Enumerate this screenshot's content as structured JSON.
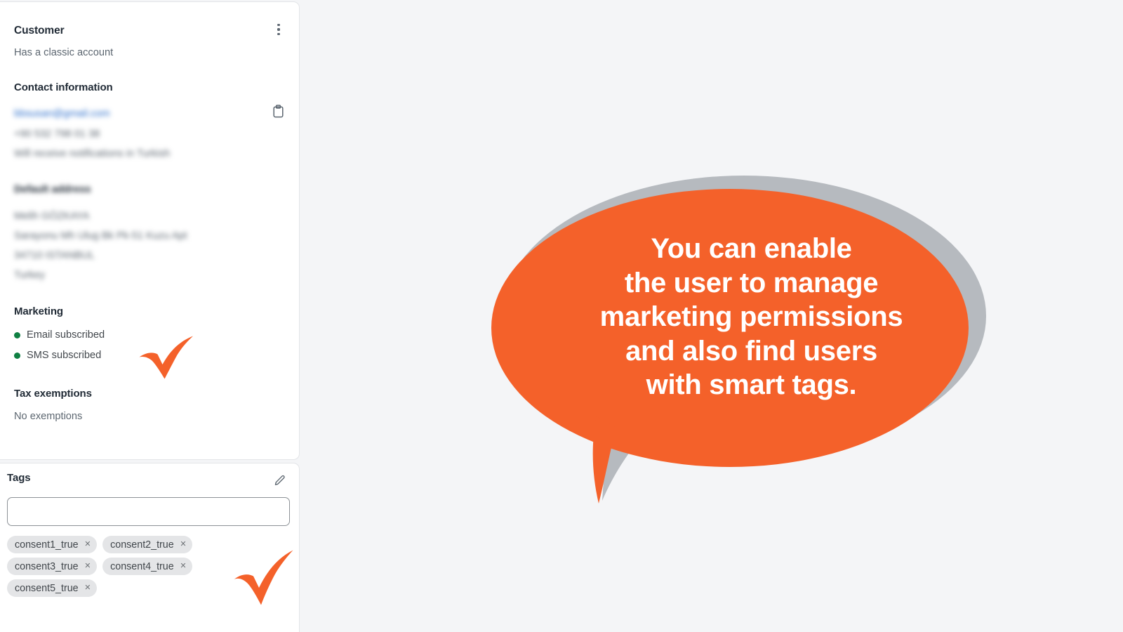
{
  "panel": {
    "customer": {
      "title": "Customer",
      "account_status": "Has a classic account",
      "menu_icon": "kebab-menu-icon"
    },
    "contact": {
      "heading": "Contact information",
      "email_redacted": "bbsusan@gmail.com",
      "phone_redacted": "+90 532 798 01 38",
      "notifications_redacted": "Will receive notifications in Turkish",
      "copy_icon": "clipboard-copy-icon"
    },
    "address": {
      "heading_redacted": "Default address",
      "line1_redacted": "Melih GÖZKAYA",
      "line2_redacted": "Sarayonu Mh Ulug Bk Pk-51 Kuzu Apt",
      "line3_redacted": "34710 ISTANBUL",
      "line4_redacted": "Turkey"
    },
    "marketing": {
      "heading": "Marketing",
      "items": [
        {
          "label": "Email subscribed",
          "status_color": "#108043"
        },
        {
          "label": "SMS subscribed",
          "status_color": "#108043"
        }
      ]
    },
    "tax": {
      "heading": "Tax exemptions",
      "value": "No exemptions"
    },
    "tags": {
      "heading": "Tags",
      "edit_icon": "pencil-edit-icon",
      "input_value": "",
      "input_placeholder": "",
      "chips": [
        "consent1_true",
        "consent2_true",
        "consent3_true",
        "consent4_true",
        "consent5_true"
      ],
      "chip_remove_glyph": "×"
    }
  },
  "annotations": {
    "checkmark_color": "#F4612A",
    "checkmark_marketing": "checkmark-marketing",
    "checkmark_tags": "checkmark-tags"
  },
  "callout": {
    "text": "You can enable\nthe user to manage\nmarketing permissions\nand also find users\nwith smart tags.",
    "bubble_color": "#F4612A",
    "shadow_color": "#B6BABF",
    "text_color": "#FFFFFF"
  },
  "colors": {
    "page_background": "#F4F5F7",
    "card_background": "#FFFFFF",
    "heading_text": "#212B36",
    "body_text": "#5C6670",
    "chip_background": "#E4E5E7"
  }
}
